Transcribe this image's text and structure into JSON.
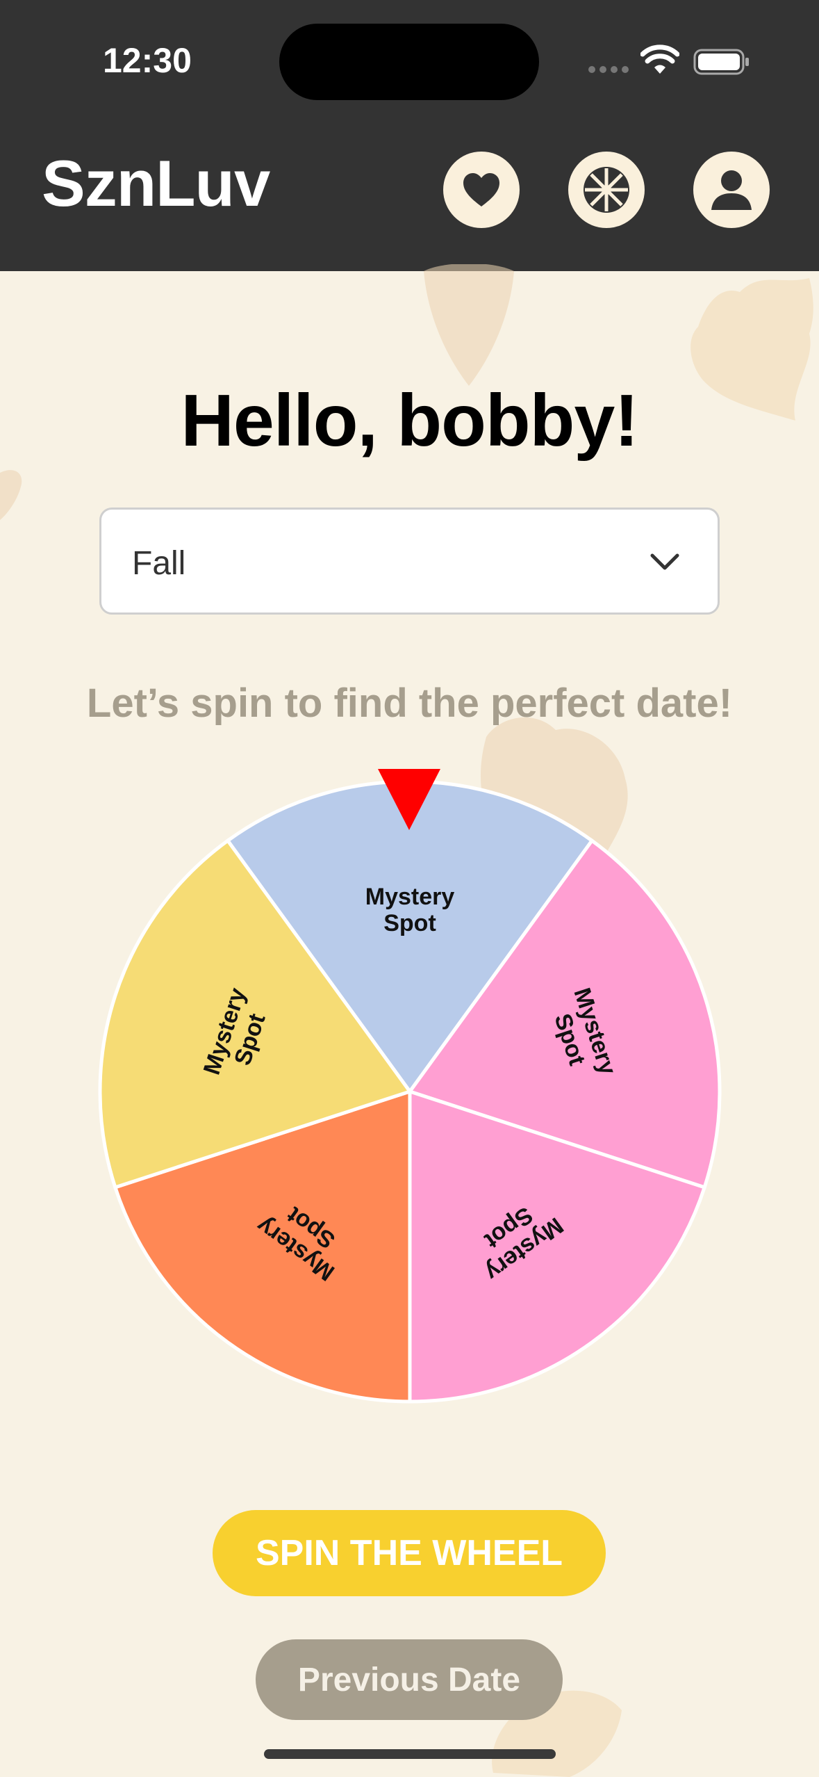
{
  "status_bar": {
    "time": "12:30"
  },
  "header": {
    "app_title": "SznLuv",
    "icons": [
      "heart-icon",
      "wheel-icon",
      "profile-icon"
    ]
  },
  "main": {
    "greeting": "Hello, bobby!",
    "season_select": {
      "value": "Fall"
    },
    "subtitle": "Let’s spin to find the perfect date!"
  },
  "wheel": {
    "segments": [
      {
        "label_line1": "Mystery",
        "label_line2": "Spot",
        "color": "#b8cbea"
      },
      {
        "label_line1": "Mystery",
        "label_line2": "Spot",
        "color": "#ff9fd2"
      },
      {
        "label_line1": "Mystery",
        "label_line2": "Spot",
        "color": "#ff9fd2"
      },
      {
        "label_line1": "Mystery",
        "label_line2": "Spot",
        "color": "#ff8855"
      },
      {
        "label_line1": "Mystery",
        "label_line2": "Spot",
        "color": "#f6dc75"
      }
    ],
    "pointer_color": "#ff0000"
  },
  "actions": {
    "spin_label": "SPIN THE WHEEL",
    "previous_label": "Previous Date"
  },
  "colors": {
    "header_bg": "#333333",
    "page_bg": "#f8f2e4",
    "accent_yellow": "#f8d02f",
    "muted": "#a69e8d"
  }
}
